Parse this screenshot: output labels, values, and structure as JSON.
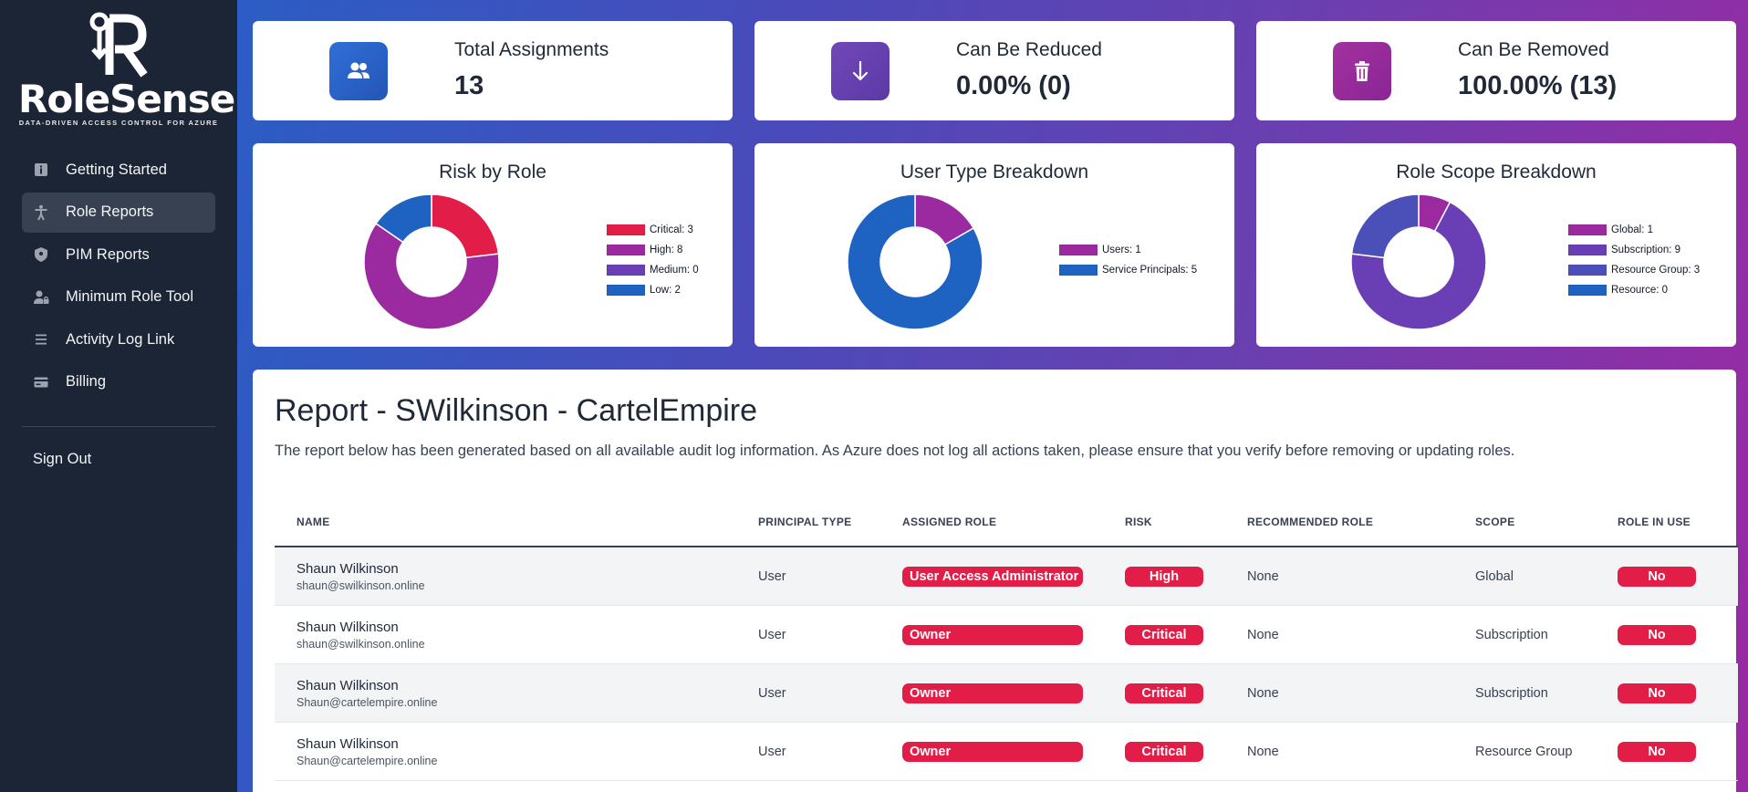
{
  "brand": {
    "name": "RoleSense",
    "tagline": "DATA-DRIVEN ACCESS CONTROL FOR AZURE"
  },
  "sidebar": {
    "items": [
      {
        "label": "Getting Started",
        "icon": "info-icon",
        "active": false
      },
      {
        "label": "Role Reports",
        "icon": "accessibility-icon",
        "active": true
      },
      {
        "label": "PIM Reports",
        "icon": "shield-icon",
        "active": false
      },
      {
        "label": "Minimum Role Tool",
        "icon": "user-lock-icon",
        "active": false
      },
      {
        "label": "Activity Log Link",
        "icon": "list-icon",
        "active": false
      },
      {
        "label": "Billing",
        "icon": "credit-card-icon",
        "active": false
      }
    ],
    "sign_out": "Sign Out"
  },
  "stats": [
    {
      "label": "Total Assignments",
      "value": "13",
      "icon": "users-icon",
      "color": "#2563c7"
    },
    {
      "label": "Can Be Reduced",
      "value": "0.00% (0)",
      "icon": "arrow-down-icon",
      "color": "#6a3fb0"
    },
    {
      "label": "Can Be Removed",
      "value": "100.00% (13)",
      "icon": "trash-icon",
      "color": "#9a2aa4"
    }
  ],
  "charts": [
    {
      "title": "Risk by Role",
      "legend": [
        "Critical: 3",
        "High: 8",
        "Medium: 0",
        "Low: 2"
      ]
    },
    {
      "title": "User Type Breakdown",
      "legend": [
        "Users: 1",
        "Service Principals: 5"
      ]
    },
    {
      "title": "Role Scope Breakdown",
      "legend": [
        "Global: 1",
        "Subscription: 9",
        "Resource Group: 3",
        "Resource: 0"
      ]
    }
  ],
  "chart_data": [
    {
      "type": "pie",
      "title": "Risk by Role",
      "categories": [
        "Critical",
        "High",
        "Medium",
        "Low"
      ],
      "values": [
        3,
        8,
        0,
        2
      ],
      "colors": [
        "#e11d48",
        "#9b2aa0",
        "#6a3fb5",
        "#1f63c2"
      ],
      "legend": "right"
    },
    {
      "type": "pie",
      "title": "User Type Breakdown",
      "categories": [
        "Users",
        "Service Principals"
      ],
      "values": [
        1,
        5
      ],
      "colors": [
        "#9b2aa0",
        "#1f63c2"
      ],
      "legend": "right"
    },
    {
      "type": "pie",
      "title": "Role Scope Breakdown",
      "categories": [
        "Global",
        "Subscription",
        "Resource Group",
        "Resource"
      ],
      "values": [
        1,
        9,
        3,
        0
      ],
      "colors": [
        "#9b2aa0",
        "#6a3fb5",
        "#4b4fb8",
        "#1f63c2"
      ],
      "legend": "right"
    }
  ],
  "report": {
    "title": "Report - SWilkinson - CartelEmpire",
    "subtitle": "The report below has been generated based on all available audit log information. As Azure does not log all actions taken, please ensure that you verify before removing or updating roles.",
    "columns": [
      "NAME",
      "PRINCIPAL TYPE",
      "ASSIGNED ROLE",
      "RISK",
      "RECOMMENDED ROLE",
      "SCOPE",
      "ROLE IN USE"
    ],
    "rows": [
      {
        "name": "Shaun Wilkinson",
        "email": "shaun@swilkinson.online",
        "ptype": "User",
        "role": "User Access Administrator",
        "risk": "High",
        "rec": "None",
        "scope": "Global",
        "inuse": "No"
      },
      {
        "name": "Shaun Wilkinson",
        "email": "shaun@swilkinson.online",
        "ptype": "User",
        "role": "Owner",
        "risk": "Critical",
        "rec": "None",
        "scope": "Subscription",
        "inuse": "No"
      },
      {
        "name": "Shaun Wilkinson",
        "email": "Shaun@cartelempire.online",
        "ptype": "User",
        "role": "Owner",
        "risk": "Critical",
        "rec": "None",
        "scope": "Subscription",
        "inuse": "No"
      },
      {
        "name": "Shaun Wilkinson",
        "email": "Shaun@cartelempire.online",
        "ptype": "User",
        "role": "Owner",
        "risk": "Critical",
        "rec": "None",
        "scope": "Resource Group",
        "inuse": "No"
      }
    ]
  }
}
